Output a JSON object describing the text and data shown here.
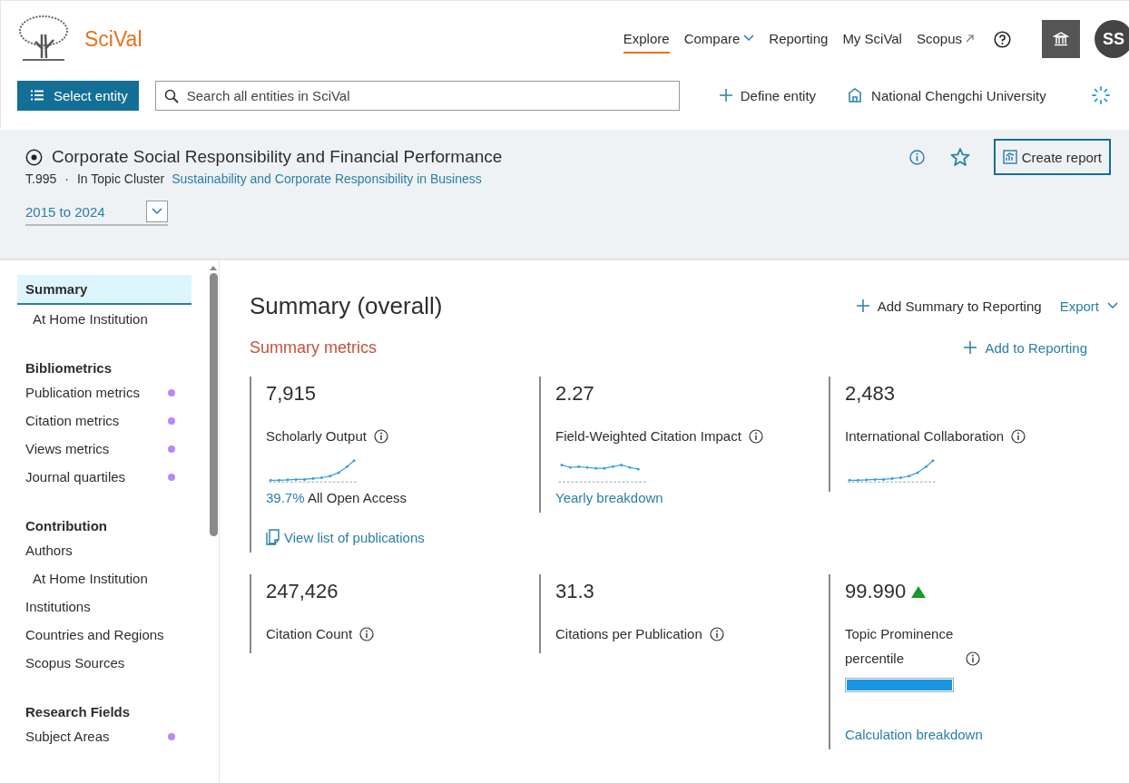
{
  "header": {
    "logo_text": "SciVal",
    "nav": [
      {
        "label": "Explore",
        "selected": true,
        "kind": "plain"
      },
      {
        "label": "Compare",
        "selected": false,
        "kind": "dropdown"
      },
      {
        "label": "Reporting",
        "selected": false,
        "kind": "plain"
      },
      {
        "label": "My SciVal",
        "selected": false,
        "kind": "plain"
      },
      {
        "label": "Scopus",
        "selected": false,
        "kind": "external"
      }
    ],
    "avatar": "SS"
  },
  "toolbar": {
    "select_button": "Select entity",
    "search": {
      "placeholder": "Search all entities in SciVal"
    },
    "define": "Define entity",
    "institution": "National Chengchi University"
  },
  "entity": {
    "title": "Corporate Social Responsibility and Financial Performance",
    "id": "T.995",
    "separator": "·",
    "cluster_prefix": "In Topic Cluster",
    "cluster_link": "Sustainability and Corporate Responsibility in Business",
    "date_range": "2015 to 2024",
    "create_report": "Create report"
  },
  "sidebar": [
    {
      "items": [
        {
          "label": "Summary",
          "selected": true,
          "children": [
            {
              "label": "At Home Institution",
              "selected": false
            }
          ]
        }
      ]
    },
    {
      "heading": "Bibliometrics",
      "items": [
        {
          "label": "Publication metrics",
          "selected": false,
          "color": "#bb88f7"
        },
        {
          "label": "Citation metrics",
          "selected": false,
          "color": "#bb88f7"
        },
        {
          "label": "Views metrics",
          "selected": false,
          "color": "#bb88f7"
        },
        {
          "label": "Journal quartiles",
          "selected": false,
          "color": "#bb88f7"
        }
      ]
    },
    {
      "heading": "Contribution",
      "items": [
        {
          "label": "Authors",
          "selected": false,
          "children": [
            {
              "label": "At Home Institution",
              "selected": false
            }
          ]
        },
        {
          "label": "Institutions",
          "selected": false
        },
        {
          "label": "Countries and Regions",
          "selected": false
        },
        {
          "label": "Scopus Sources",
          "selected": false
        }
      ]
    },
    {
      "heading": "Research Fields",
      "items": [
        {
          "label": "Subject Areas",
          "selected": false,
          "color": "#bb88f7"
        }
      ]
    }
  ],
  "main": {
    "title": "Summary (overall)",
    "add_summary": "Add Summary to Reporting",
    "export": "Export",
    "section": "Summary metrics",
    "add_reporting": "Add to Reporting",
    "metric_rows": [
      [
        {
          "value": "7,915",
          "label": "Scholarly Output",
          "kind": "growth",
          "up_arrow": false,
          "oa_percent": "39.7%",
          "oa_text": "All Open Access",
          "action": "View list of publications"
        },
        {
          "value": "2.27",
          "label": "Field-Weighted Citation Impact",
          "kind": "steady",
          "up_arrow": false,
          "link": "Yearly breakdown"
        },
        {
          "value": "2,483",
          "label": "International Collaboration",
          "kind": "growth",
          "up_arrow": false
        }
      ],
      [
        {
          "value": "247,426",
          "label": "Citation Count",
          "kind": "plain",
          "up_arrow": false
        },
        {
          "value": "31.3",
          "label": "Citations per Publication",
          "kind": "plain",
          "up_arrow": false
        },
        {
          "value": "99.990",
          "label": "Topic Prominence percentile",
          "kind": "plain",
          "up_arrow": true,
          "level": 1,
          "link": "Calculation breakdown"
        }
      ]
    ]
  }
}
